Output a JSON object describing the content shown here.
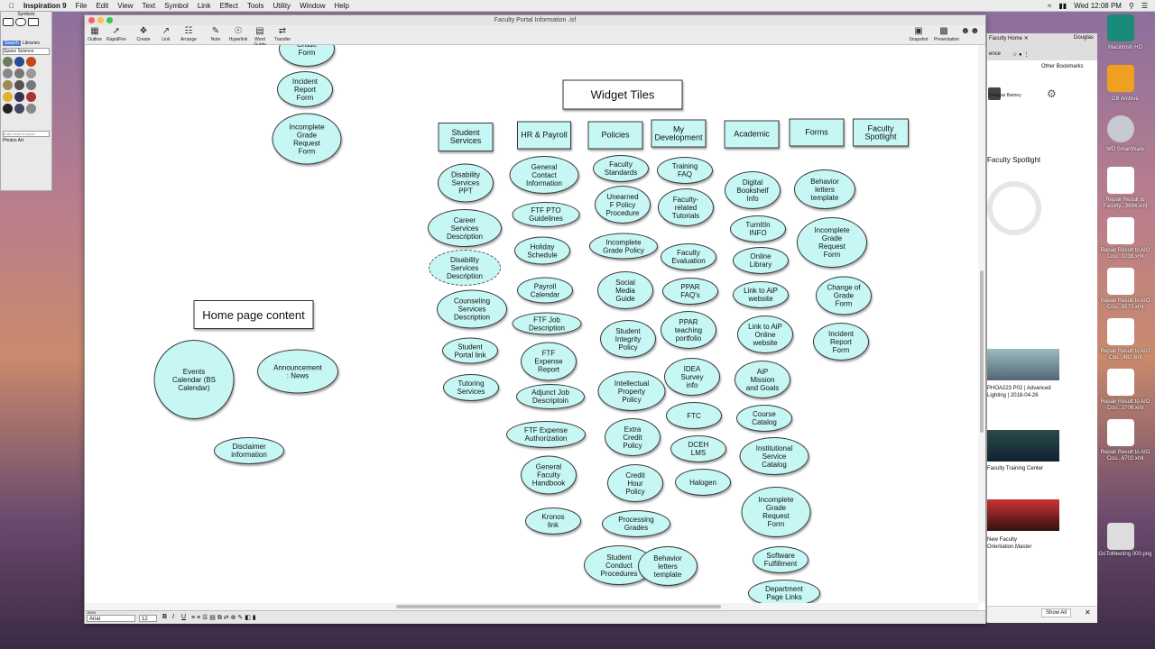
{
  "menubar": {
    "app": "Inspiration 9",
    "items": [
      "File",
      "Edit",
      "View",
      "Text",
      "Symbol",
      "Link",
      "Effect",
      "Tools",
      "Utility",
      "Window",
      "Help"
    ],
    "clock": "Wed 12:08 PM"
  },
  "palette": {
    "title": "Symbols",
    "tabs": [
      "Search",
      "Libraries"
    ],
    "library": "Space Science",
    "search_placeholder": "Enter search words",
    "opt1": "Photos",
    "opt2": "Art"
  },
  "window": {
    "title": "Faculty Portal Information .isf",
    "toolbar": [
      "Outline",
      "RapidFire",
      "Create",
      "Link",
      "Arrange",
      "Note",
      "Hyperlink",
      "Word Guide",
      "Transfer"
    ],
    "toolbar_right": [
      "Snapshot",
      "Presentation"
    ],
    "font": "Arial",
    "size": "12",
    "zoom": "150%"
  },
  "diagram": {
    "boxes": {
      "widget_tiles": "Widget Tiles",
      "home_page": "Home page content"
    },
    "headers": [
      "Student\nServices",
      "HR & Payroll",
      "Policies",
      "My\nDevelopment",
      "Academic",
      "Forms",
      "Faculty\nSpotlight"
    ],
    "left_column": [
      "Grade\nForm",
      "Incident\nReport\nForm",
      "Incomplete\nGrade\nRequest\nForm"
    ],
    "home": [
      "Events\nCalendar  (BS\nCalendar)",
      "Announcement\n: News",
      "Disclaimer\ninformation"
    ],
    "student_services": [
      "Disability\nServices\nPPT",
      "Career\nServices\nDescription",
      "Disability\nServices\nDescription",
      "Counseling\nServices\nDescription",
      "Student\nPortal link",
      "Tutoring\nServices"
    ],
    "hr_payroll": [
      "General\nContact\nInformation",
      "FTF PTO\nGuidelines",
      "Holiday\nSchedule",
      "Payroll\nCalendar",
      "FTF Job\nDescription",
      "FTF\nExpense\nReport",
      "Adjunct Job\nDescriptoin",
      "FTF Expense\nAuthorization",
      "General\nFaculty\nHandbook",
      "Kronos\nlink"
    ],
    "policies": [
      "Faculty\nStandards",
      "Unearned\nF Policy\nProcedure",
      "Incomplete\nGrade Policy",
      "Social\nMedia\nGuide",
      "Student\nIntegrity\nPolicy",
      "Intellectual\nProperty\nPolicy",
      "Extra\nCredit\nPolicy",
      "Credit\nHour\nPolicy",
      "Processing\nGrades",
      "Student\nConduct\nProcedures",
      "Behavior\nletters\ntemplate"
    ],
    "my_development": [
      "Training\nFAQ",
      "Faculty-\nrelated\nTutorials",
      "Faculty\nEvaluation",
      "PPAR\nFAQ's",
      "PPAR\nteaching\nportfolio",
      "IDEA\nSurvey\ninfo",
      "FTC",
      "DCEH\nLMS",
      "Halogen"
    ],
    "academic": [
      "Digital\nBookshelf\nInfo",
      "TurnItIn\nINFO",
      "Online\nLibrary",
      "Link to AiP\nwebsite",
      "Link to AiP\nOnline\nwebsite",
      "AiP\nMission\nand Goals",
      "Course\nCatalog",
      "Institutional\nService\nCatalog",
      "Incomplete\nGrade\nRequest\nForm",
      "Software\nFulfillment",
      "Department\nPage Links"
    ],
    "forms": [
      "Behavior\nletters\ntemplate",
      "Incomplete\nGrade\nRequest\nForm",
      "Change of\nGrade\nForm",
      "Incident\nReport\nForm"
    ]
  },
  "browser": {
    "tab": "Faculty Home",
    "user": "Douglas",
    "other_bookmarks": "Other Bookmarks",
    "ence": "ence",
    "profile_name": "Douglas Barney",
    "spotlight": "Faculty Spotlight",
    "card1": "PHOA223 P02 | Advanced Lighting | 2018-04-26",
    "card2": "Faculty Training Center",
    "card3": "New Faculty Orientation.Master",
    "show_all": "Show All"
  },
  "dock": {
    "items": [
      "Macintosh HD",
      "DB Archive",
      "WD SmartWare",
      "Repair Result to Faculty...3684.xml",
      "Repair Result to AIO Cou...1038.xml",
      "Repair Result to AIO Cou...5972.xml",
      "Repair Result to AIO Cou...482.xml",
      "Repair Result to AIO Cou...3706.xml",
      "Repair Result to AIO Cou...6702.xml",
      "GoToMeeting 000.png"
    ]
  }
}
